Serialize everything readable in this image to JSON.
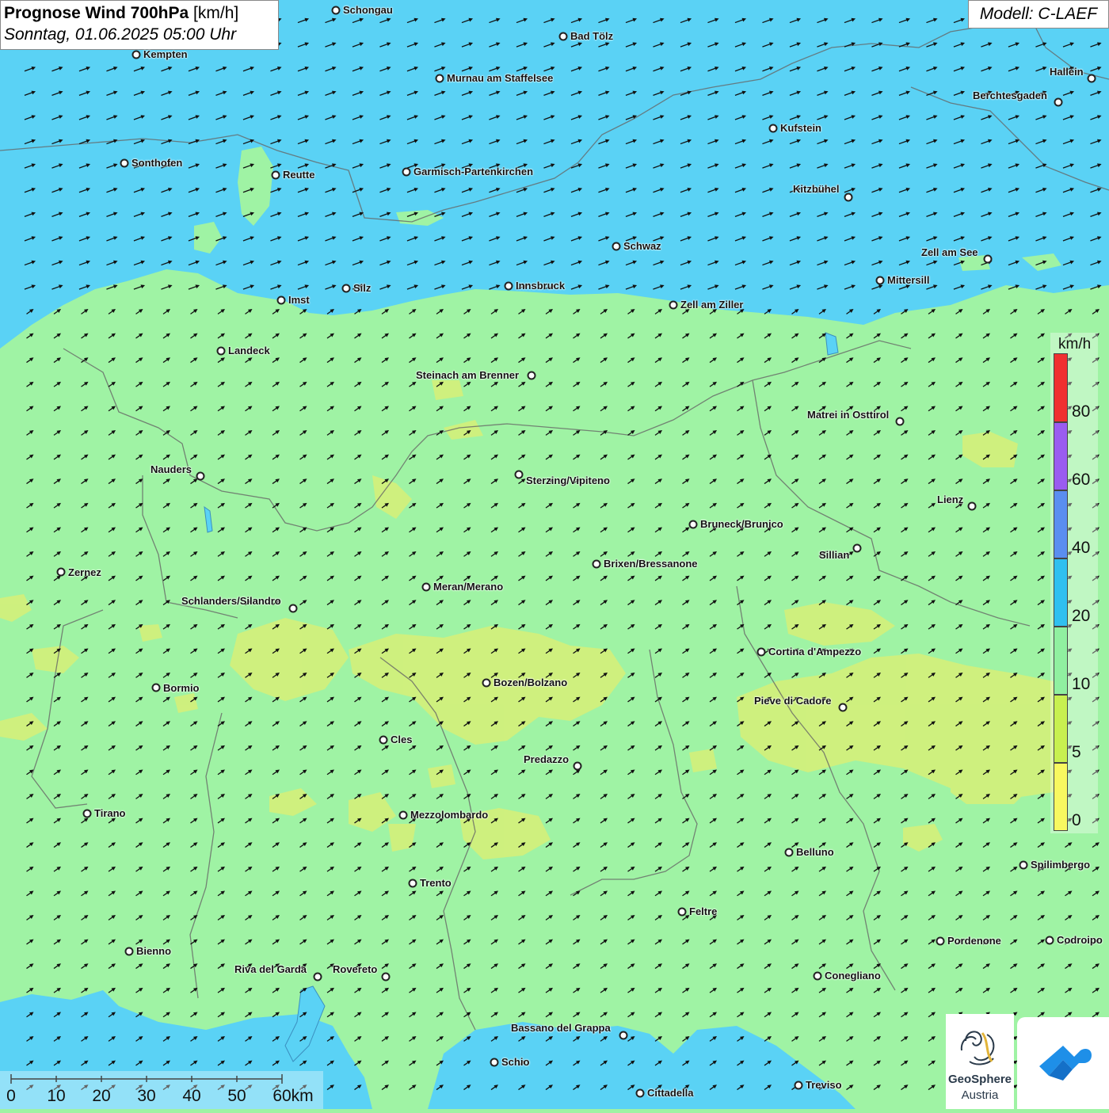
{
  "title": {
    "main": "Prognose Wind 700hPa",
    "unit": "[km/h]",
    "datetime": "Sonntag, 01.06.2025 05:00 Uhr"
  },
  "model_label": "Modell: C-LAEF",
  "legend": {
    "unit": "km/h",
    "ticks": [
      "80",
      "60",
      "40",
      "20",
      "10",
      "5",
      "0"
    ],
    "colors": [
      "#f03030",
      "#9a5cf0",
      "#5a8ef0",
      "#30c0f0",
      "#90f0a0",
      "#c8f050",
      "#f8f860"
    ]
  },
  "scale_bar": {
    "labels": [
      "0",
      "10",
      "20",
      "30",
      "40",
      "50",
      "60km"
    ]
  },
  "map_colors": {
    "high_wind": "#5ad2f5",
    "medium_wind": "#9ff3a4",
    "low_wind": "#d4f07a"
  },
  "cities": [
    {
      "name": "Schongau"
    },
    {
      "name": "Bad Tölz"
    },
    {
      "name": "Kempten"
    },
    {
      "name": "Murnau am Staffelsee"
    },
    {
      "name": "Hallein"
    },
    {
      "name": "Berchtesgaden"
    },
    {
      "name": "Kufstein"
    },
    {
      "name": "Sonthofen"
    },
    {
      "name": "Reutte"
    },
    {
      "name": "Garmisch-Partenkirchen"
    },
    {
      "name": "Kitzbühel"
    },
    {
      "name": "Schwaz"
    },
    {
      "name": "Zell am See"
    },
    {
      "name": "Mittersill"
    },
    {
      "name": "Silz"
    },
    {
      "name": "Innsbruck"
    },
    {
      "name": "Imst"
    },
    {
      "name": "Zell am Ziller"
    },
    {
      "name": "Landeck"
    },
    {
      "name": "Steinach am Brenner"
    },
    {
      "name": "Matrei in Osttirol"
    },
    {
      "name": "Nauders"
    },
    {
      "name": "Sterzing/Vipiteno"
    },
    {
      "name": "Lienz"
    },
    {
      "name": "Bruneck/Brunico"
    },
    {
      "name": "Sillian"
    },
    {
      "name": "Zernez"
    },
    {
      "name": "Brixen/Bressanone"
    },
    {
      "name": "Meran/Merano"
    },
    {
      "name": "Schlanders/Silandro"
    },
    {
      "name": "Cortina d'Ampezzo"
    },
    {
      "name": "Bozen/Bolzano"
    },
    {
      "name": "Bormio"
    },
    {
      "name": "Pieve di Cadore"
    },
    {
      "name": "Cles"
    },
    {
      "name": "Predazzo"
    },
    {
      "name": "Tirano"
    },
    {
      "name": "Mezzolombardo"
    },
    {
      "name": "Belluno"
    },
    {
      "name": "Spilimbergo"
    },
    {
      "name": "Trento"
    },
    {
      "name": "Feltre"
    },
    {
      "name": "Pordenone"
    },
    {
      "name": "Codroipo"
    },
    {
      "name": "Bienno"
    },
    {
      "name": "Riva del Garda"
    },
    {
      "name": "Rovereto"
    },
    {
      "name": "Conegliano"
    },
    {
      "name": "Bassano del Grappa"
    },
    {
      "name": "Schio"
    },
    {
      "name": "Treviso"
    },
    {
      "name": "Cittadella"
    }
  ],
  "logo": {
    "line1": "GeoSphere",
    "line2": "Austria"
  }
}
